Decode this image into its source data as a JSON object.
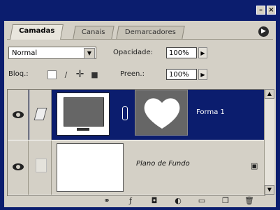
{
  "window": {
    "minimize_glyph": "–",
    "close_glyph": "×"
  },
  "tabs": [
    {
      "label": "Camadas",
      "active": true
    },
    {
      "label": "Canais",
      "active": false
    },
    {
      "label": "Demarcadores",
      "active": false
    }
  ],
  "panel_menu_icon": "panel-menu-arrow",
  "blend": {
    "mode": "Normal",
    "opacity_label": "Opacidade:",
    "opacity_value": "100%"
  },
  "lock": {
    "label": "Bloq.:",
    "fill_label": "Preen.:",
    "fill_value": "100%"
  },
  "layers": [
    {
      "name": "Forma 1",
      "selected": true,
      "visible": true
    },
    {
      "name": "Plano de Fundo",
      "selected": false,
      "visible": true,
      "locked": true
    }
  ],
  "bottom_icons": [
    "link-layers-icon",
    "add-style-icon",
    "add-mask-icon",
    "new-fill-layer-icon",
    "new-group-icon",
    "new-layer-icon",
    "trash-icon"
  ],
  "colors": {
    "titlebar": "#0b1d6e",
    "selection": "#0b1d6e",
    "panel": "#d4d0c6"
  }
}
